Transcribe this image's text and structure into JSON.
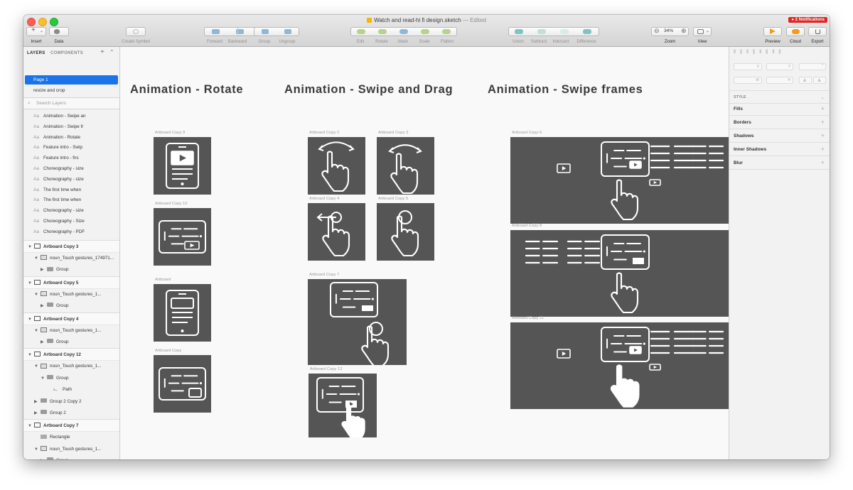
{
  "window": {
    "title": "Watch and read-hi fi design.sketch",
    "edited": "— Edited",
    "notifications": "● 2 Notifications"
  },
  "toolbar": {
    "insert": "Insert",
    "data": "Data",
    "create_symbol": "Create Symbol",
    "forward": "Forward",
    "backward": "Backward",
    "group": "Group",
    "ungroup": "Ungroup",
    "edit": "Edit",
    "rotate": "Rotate",
    "mask": "Mask",
    "scale": "Scale",
    "flatten": "Flatten",
    "union": "Union",
    "subtract": "Subtract",
    "intersect": "Intersect",
    "difference": "Difference",
    "zoom_value": "34%",
    "zoom": "Zoom",
    "view": "View",
    "preview": "Preview",
    "cloud": "Cloud",
    "export": "Export"
  },
  "sidebar": {
    "tab_layers": "LAYERS",
    "tab_components": "COMPONENTS",
    "pages": [
      "Page 1",
      "resize and crop"
    ],
    "search_placeholder": "Search Layers",
    "text_layers": [
      "Animation - Swipe an",
      "Animation - Swipe fr",
      "Animation - Rotate",
      "Feature intro - Swip",
      "Feature intro - firs",
      "Choreography - size",
      "Choreography - size",
      "The first time when",
      "The first time when",
      "Choreography - size",
      "Choreography - Size",
      "Choreography - PDF"
    ],
    "tree": [
      "Artboard Copy 3",
      "noun_Touch gestures_174971...",
      "Group",
      "Artboard Copy 5",
      "noun_Touch gestures_1...",
      "Group",
      "Artboard Copy 4",
      "noun_Touch gestures_1...",
      "Group",
      "Artboard Copy 12",
      "noun_Touch gestures_1...",
      "Group",
      "Path",
      "Group 2 Copy 2",
      "Group 2",
      "Artboard Copy 7",
      "Rectangle",
      "noun_Touch gestures_1...",
      "Group"
    ]
  },
  "canvas": {
    "titles": [
      "Animation - Rotate",
      "Animation - Swipe and Drag",
      "Animation - Swipe frames"
    ],
    "artboards": [
      "Artboard Copy 9",
      "Artboard Copy 10",
      "Artboard",
      "Artboard Copy",
      "Artboard Copy 2",
      "Artboard Copy 3",
      "Artboard Copy 4",
      "Artboard Copy 5",
      "Artboard Copy 7",
      "Artboard Copy 12",
      "Artboard Copy 6",
      "Artboard Copy 8",
      "Artboard Copy 11"
    ]
  },
  "inspector": {
    "x": "X",
    "y": "Y",
    "w": "W",
    "h": "H",
    "style": "STYLE",
    "sections": [
      "Fills",
      "Borders",
      "Shadows",
      "Inner Shadows",
      "Blur"
    ]
  },
  "colors": {
    "selection": "#1a73e8",
    "artboard": "#555555",
    "notification": "#e02424"
  }
}
